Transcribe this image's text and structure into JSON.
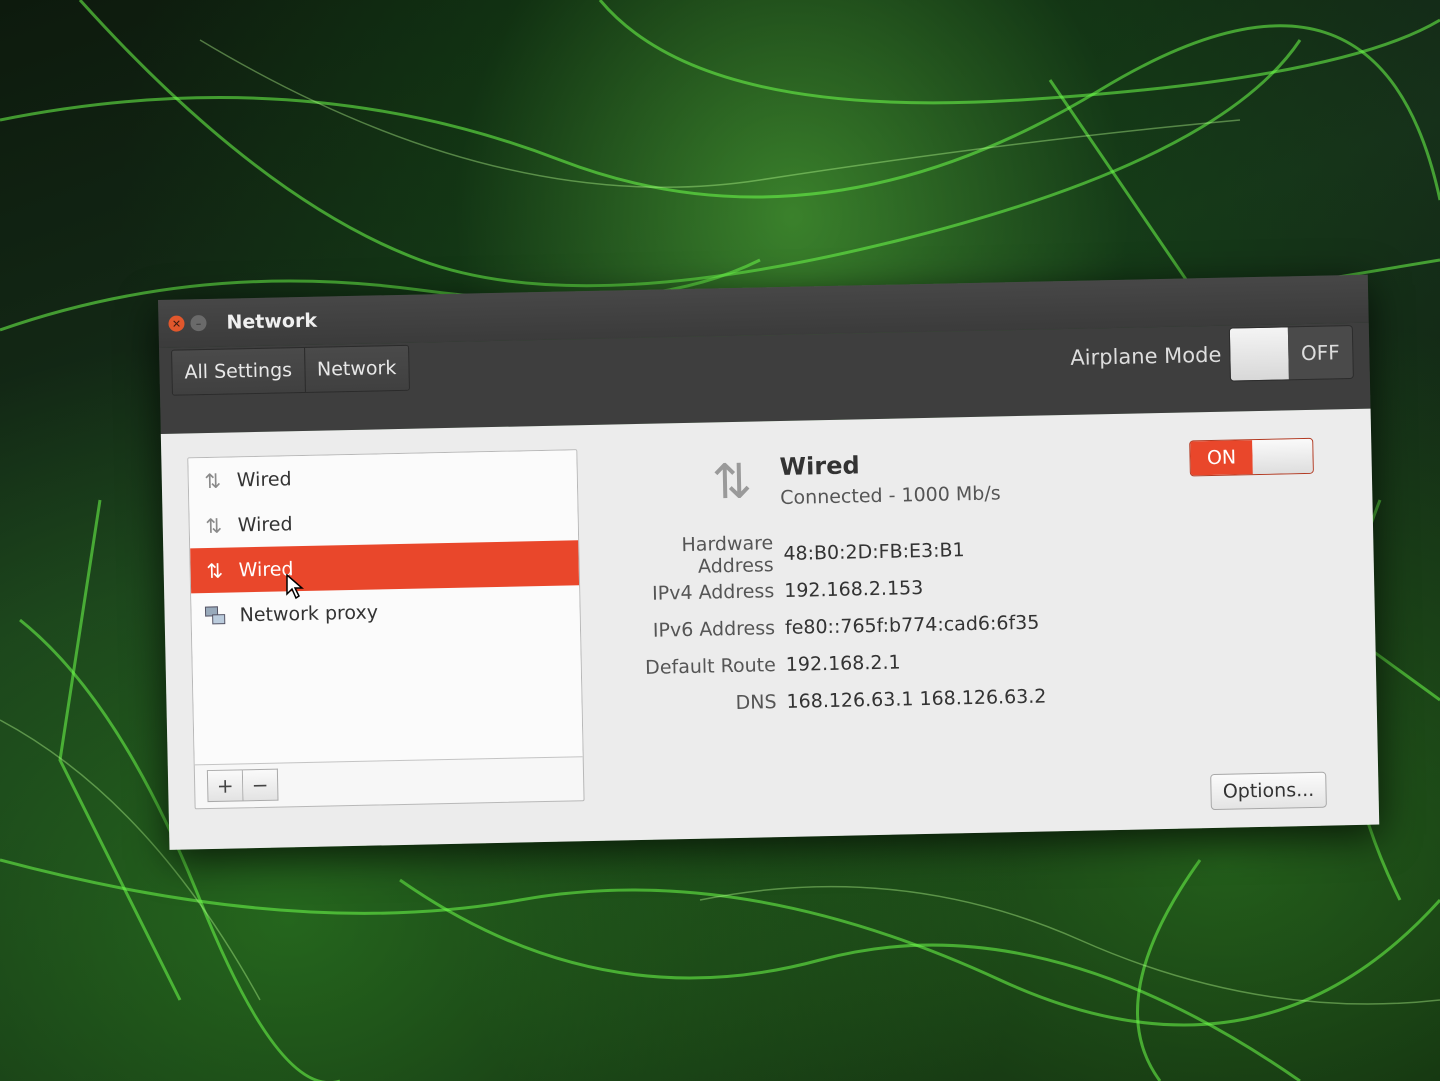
{
  "window": {
    "title": "Network",
    "close_icon": "close-icon",
    "minimize_icon": "minimize-icon"
  },
  "toolbar": {
    "breadcrumb": [
      "All Settings",
      "Network"
    ],
    "airplane_mode_label": "Airplane Mode",
    "airplane_mode_state": "OFF"
  },
  "sidebar": {
    "items": [
      {
        "label": "Wired",
        "icon": "wired-icon",
        "selected": false
      },
      {
        "label": "Wired",
        "icon": "wired-icon",
        "selected": false
      },
      {
        "label": "Wired",
        "icon": "wired-icon",
        "selected": true
      },
      {
        "label": "Network proxy",
        "icon": "network-proxy-icon",
        "selected": false
      }
    ],
    "add_label": "+",
    "remove_label": "−"
  },
  "detail": {
    "title": "Wired",
    "status": "Connected - 1000 Mb/s",
    "switch_state": "ON",
    "properties": [
      {
        "label": "Hardware Address",
        "value": "48:B0:2D:FB:E3:B1"
      },
      {
        "label": "IPv4 Address",
        "value": "192.168.2.153"
      },
      {
        "label": "IPv6 Address",
        "value": "fe80::765f:b774:cad6:6f35"
      },
      {
        "label": "Default Route",
        "value": "192.168.2.1"
      },
      {
        "label": "DNS",
        "value": "168.126.63.1 168.126.63.2"
      }
    ],
    "options_label": "Options..."
  },
  "colors": {
    "accent": "#e9472b",
    "titlebar": "#3e3e3e",
    "content": "#ececec"
  }
}
